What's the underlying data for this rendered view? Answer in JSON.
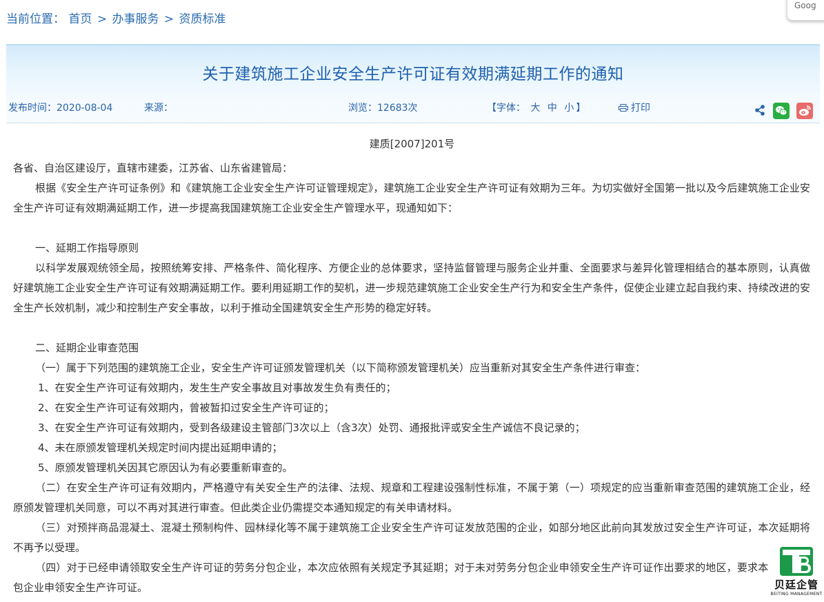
{
  "breadcrumb": {
    "label": "当前位置：",
    "home": "首页",
    "section": "办事服务",
    "current": "资质标准",
    "separator": ">"
  },
  "google_tab": {
    "label": "Goog"
  },
  "article": {
    "title": "关于建筑施工企业安全生产许可证有效期满延期工作的通知",
    "publish_label": "发布时间：",
    "publish_date": "2020-08-04",
    "source_label": "来源：",
    "views_label": "浏览：",
    "views_count": "12683次",
    "font_label": "【字体：",
    "font_large": "大",
    "font_medium": "中",
    "font_small": "小",
    "font_close": "】",
    "print_label": "打印",
    "doc_number": "建质[2007]201号"
  },
  "icons": {
    "share": "share-icon",
    "wechat": "wechat-icon",
    "weibo": "weibo-icon",
    "print": "printer-icon",
    "wechat_color": "#2aae43",
    "weibo_color": "#e86a6a",
    "link_color": "#2a63a8"
  },
  "body": {
    "addressee": "各省、自治区建设厅，直辖市建委，江苏省、山东省建管局：",
    "intro": "根据《安全生产许可证条例》和《建筑施工企业安全生产许可证管理规定》，建筑施工企业安全生产许可证有效期为三年。为切实做好全国第一批以及今后建筑施工企业安全生产许可证有效期满延期工作，进一步提高我国建筑施工企业安全生产管理水平，现通知如下：",
    "sec1_heading": "一、延期工作指导原则",
    "sec1_text": "以科学发展观统领全局，按照统筹安排、严格条件、简化程序、方便企业的总体要求，坚持监督管理与服务企业并重、全面要求与差异化管理相结合的基本原则，认真做好建筑施工企业安全生产许可证有效期满延期工作。要利用延期工作的契机，进一步规范建筑施工企业安全生产行为和安全生产条件，促使企业建立起自我约束、持续改进的安全生产长效机制，减少和控制生产安全事故，以利于推动全国建筑安全生产形势的稳定好转。",
    "sec2_heading": "二、延期企业审查范围",
    "sec2_item1": "（一）属于下列范围的建筑施工企业，安全生产许可证颁发管理机关（以下简称颁发管理机关）应当重新对其安全生产条件进行审查：",
    "sec2_sub1": "1、在安全生产许可证有效期内，发生生产安全事故且对事故发生负有责任的；",
    "sec2_sub2": "2、在安全生产许可证有效期内，曾被暂扣过安全生产许可证的；",
    "sec2_sub3": "3、在安全生产许可证有效期内，受到各级建设主管部门3次以上（含3次）处罚、通报批评或安全生产诚信不良记录的；",
    "sec2_sub4": "4、未在原颁发管理机关规定时间内提出延期申请的；",
    "sec2_sub5": "5、原颁发管理机关因其它原因认为有必要重新审查的。",
    "sec2_item2": "（二）在安全生产许可证有效期内，严格遵守有关安全生产的法律、法规、规章和工程建设强制性标准，不属于第（一）项规定的应当重新审查范围的建筑施工企业，经原颁发管理机关同意，可以不再对其进行审查。但此类企业仍需提交本通知规定的有关申请材料。",
    "sec2_item3": "（三）对预拌商品混凝土、混凝土预制构件、园林绿化等不属于建筑施工企业安全生产许可证发放范围的企业，如部分地区此前向其发放过安全生产许可证，本次延期将不再予以受理。",
    "sec2_item4": "（四）对于已经申请领取安全生产许可证的劳务分包企业，本次应依照有关规定予其延期；对于未对劳务分包企业申领安全生产许可证作出要求的地区，要求本地劳务分包企业申领安全生产许可证。"
  },
  "watermark": {
    "name": "贝廷企管",
    "english": "BEITING MANAGEMENT",
    "color": "#1c9a49"
  }
}
